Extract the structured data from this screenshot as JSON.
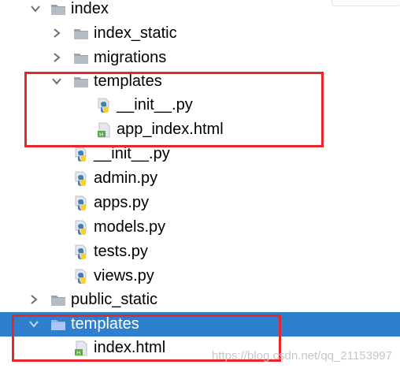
{
  "tree": {
    "items": [
      {
        "label": "index",
        "kind": "folder",
        "expanded": true
      },
      {
        "label": "index_static",
        "kind": "folder",
        "expanded": false
      },
      {
        "label": "migrations",
        "kind": "folder",
        "expanded": false
      },
      {
        "label": "templates",
        "kind": "folder",
        "expanded": true
      },
      {
        "label": "__init__.py",
        "kind": "python-file"
      },
      {
        "label": "app_index.html",
        "kind": "html-file"
      },
      {
        "label": "__init__.py",
        "kind": "python-file"
      },
      {
        "label": "admin.py",
        "kind": "python-file"
      },
      {
        "label": "apps.py",
        "kind": "python-file"
      },
      {
        "label": "models.py",
        "kind": "python-file"
      },
      {
        "label": "tests.py",
        "kind": "python-file"
      },
      {
        "label": "views.py",
        "kind": "python-file"
      },
      {
        "label": "public_static",
        "kind": "folder",
        "expanded": false
      },
      {
        "label": "templates",
        "kind": "folder",
        "expanded": true,
        "selected": true
      },
      {
        "label": "index.html",
        "kind": "html-file"
      }
    ]
  },
  "watermark": "https://blog.csdn.net/qq_21153997",
  "colors": {
    "selection": "#2f7fcf",
    "highlight_box": "#e8262b",
    "folder_gray": "#9aa3ad",
    "folder_selected": "#8fb3f0",
    "python_blue": "#3c7ebf",
    "python_yellow": "#f7cf3b",
    "html_green": "#5aa84a"
  }
}
